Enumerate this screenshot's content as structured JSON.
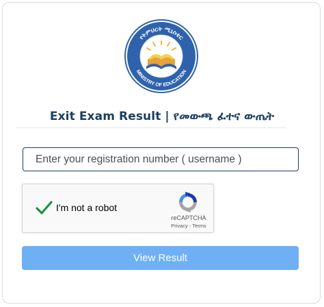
{
  "logo": {
    "arc_text": "የትምህርት ሚኒስቴር",
    "bottom_text": "MINISTRY OF EDUCATION"
  },
  "title": "Exit Exam Result | የመውጫ ፈተና ውጤት",
  "registration": {
    "placeholder": "Enter your registration number ( username )"
  },
  "recaptcha": {
    "label": "I'm not a robot",
    "brand": "reCAPTCHA",
    "privacy": "Privacy",
    "separator": " - ",
    "terms": "Terms",
    "checked": true
  },
  "view_button": {
    "label": "View Result"
  },
  "colors": {
    "primary": "#1c3f60",
    "button": "#6fb0f5",
    "check": "#179446",
    "logo_blue": "#2f62ac"
  }
}
